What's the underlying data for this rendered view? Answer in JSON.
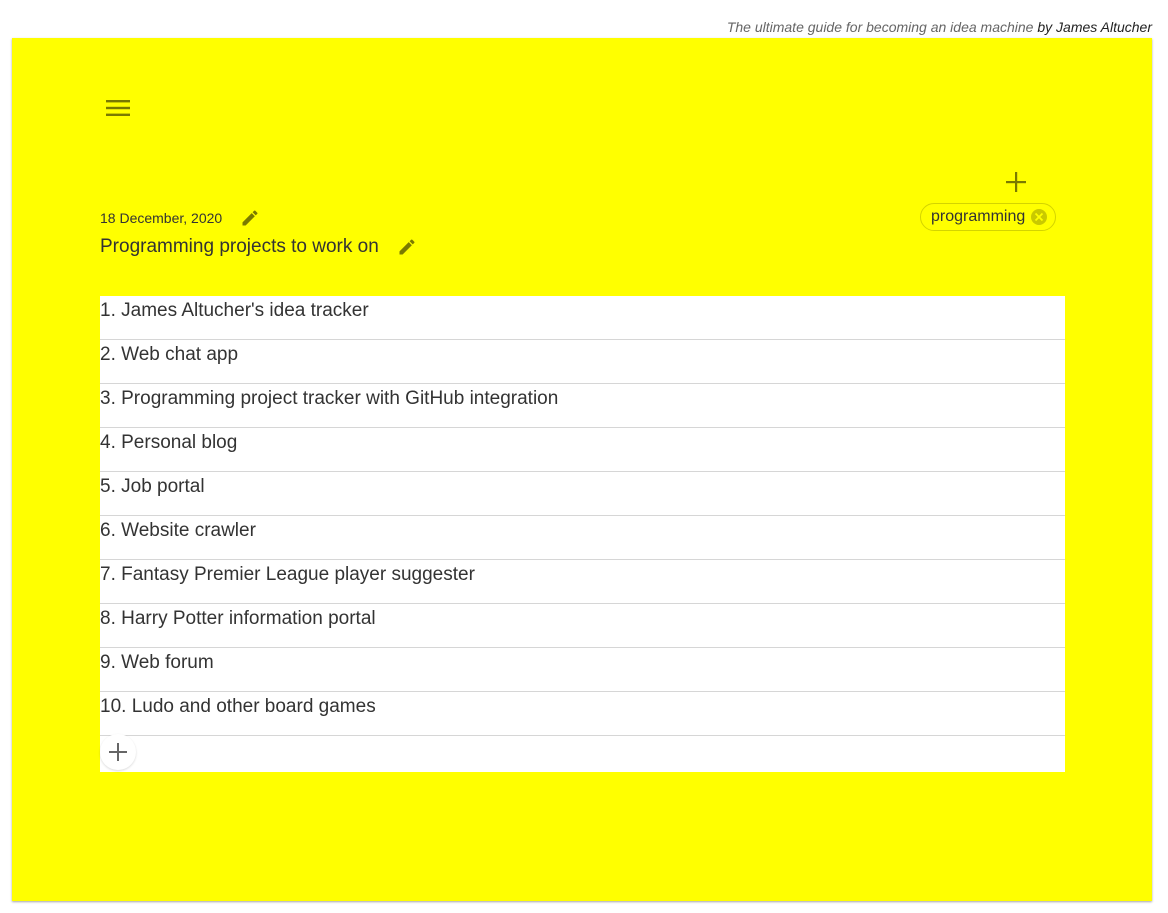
{
  "header": {
    "guide_text": "The ultimate guide for becoming an idea machine",
    "author_text": "by James Altucher"
  },
  "note": {
    "background_color": "#ffff00",
    "date": "18 December, 2020",
    "title": "Programming projects to work on",
    "tags": [
      {
        "label": "programming"
      }
    ],
    "items": [
      "1. James Altucher's idea tracker",
      "2. Web chat app",
      "3. Programming project tracker with GitHub integration",
      "4. Personal blog",
      "5. Job portal",
      "6. Website crawler",
      "7. Fantasy Premier League player suggester",
      "8. Harry Potter information portal",
      "9. Web forum",
      "10. Ludo and other board games"
    ]
  },
  "icons": {
    "menu": "menu-icon",
    "add_tag": "plus-icon",
    "remove_tag": "close-circle-icon",
    "edit_date": "pencil-icon",
    "edit_title": "pencil-icon",
    "add_item": "plus-icon"
  },
  "colors": {
    "accent": "#ffff00",
    "icon": "#7a7a00",
    "chip_border": "#d4d400"
  }
}
